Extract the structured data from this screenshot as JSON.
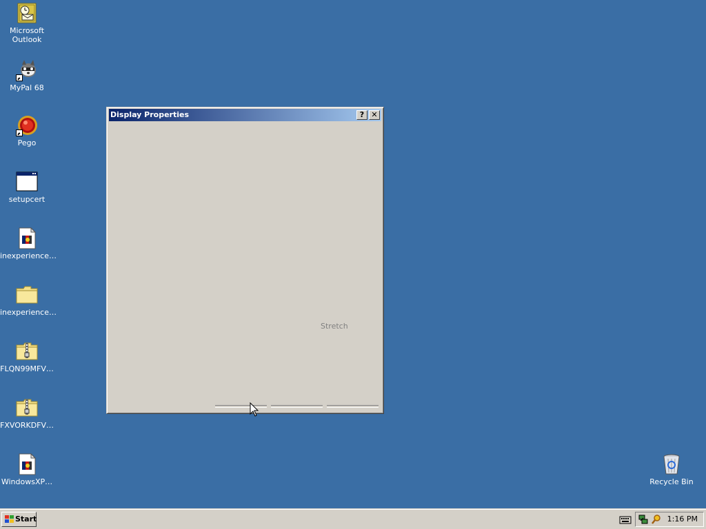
{
  "desktop": {
    "icons": [
      {
        "label_line1": "Microsoft",
        "label_line2": "Outlook",
        "icon": "outlook-icon"
      },
      {
        "label_line1": "MyPal 68",
        "icon": "raccoon-icon"
      },
      {
        "label_line1": "Pego",
        "icon": "pego-icon"
      },
      {
        "label_line1": "setupcert",
        "icon": "application-window-icon"
      },
      {
        "label_line1": "inexperience…",
        "icon": "media-file-icon"
      },
      {
        "label_line1": "inexperience…",
        "icon": "folder-icon"
      },
      {
        "label_line1": "FLQN99MFV…",
        "icon": "zip-folder-icon"
      },
      {
        "label_line1": "FXVORKDFV…",
        "icon": "zip-folder-icon"
      },
      {
        "label_line1": "WindowsXP…",
        "icon": "media-file-icon"
      }
    ],
    "recycle_bin": {
      "label": "Recycle Bin",
      "icon": "recycle-bin-icon"
    },
    "background_color": "#3a6ea5"
  },
  "dialog": {
    "title": "Display Properties",
    "help_button": "?",
    "close_button": "✕",
    "stretch_label": "Stretch",
    "title_color_start": "#0a246a",
    "title_color_end": "#a6caf0"
  },
  "taskbar": {
    "start_label": "Start",
    "clock": "1:16 PM",
    "tray_icons": [
      "keyboard-icon",
      "network-icon",
      "search-icon"
    ]
  }
}
